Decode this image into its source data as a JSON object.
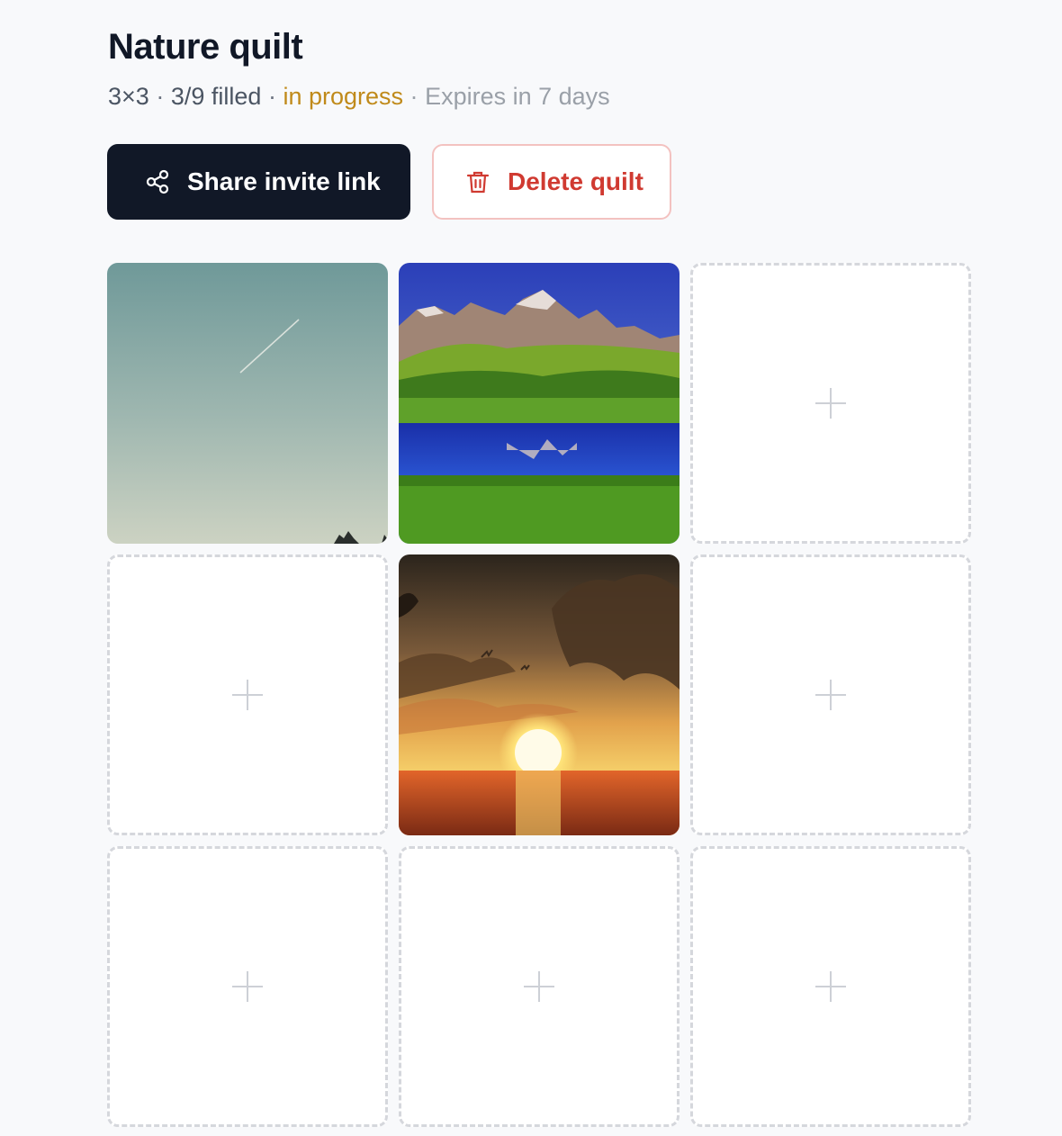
{
  "quilt": {
    "title": "Nature quilt",
    "grid_size": "3×3",
    "filled_text": "3/9 filled",
    "separator": "·",
    "status": "in progress",
    "expires": "Expires in 7 days"
  },
  "actions": {
    "share_label": "Share invite link",
    "delete_label": "Delete quilt"
  },
  "colors": {
    "primary_dark": "#111827",
    "status_amber": "#c08a1a",
    "danger_red": "#d03a31",
    "empty_border": "#d5d7dc"
  },
  "tiles": [
    {
      "state": "filled",
      "image": "sky-contrail-photo"
    },
    {
      "state": "filled",
      "image": "mountain-lake-photo"
    },
    {
      "state": "empty",
      "icon": "plus-icon"
    },
    {
      "state": "empty",
      "icon": "plus-icon"
    },
    {
      "state": "filled",
      "image": "ocean-sunset-photo"
    },
    {
      "state": "empty",
      "icon": "plus-icon"
    },
    {
      "state": "empty",
      "icon": "plus-icon"
    },
    {
      "state": "empty",
      "icon": "plus-icon"
    },
    {
      "state": "empty",
      "icon": "plus-icon"
    }
  ]
}
